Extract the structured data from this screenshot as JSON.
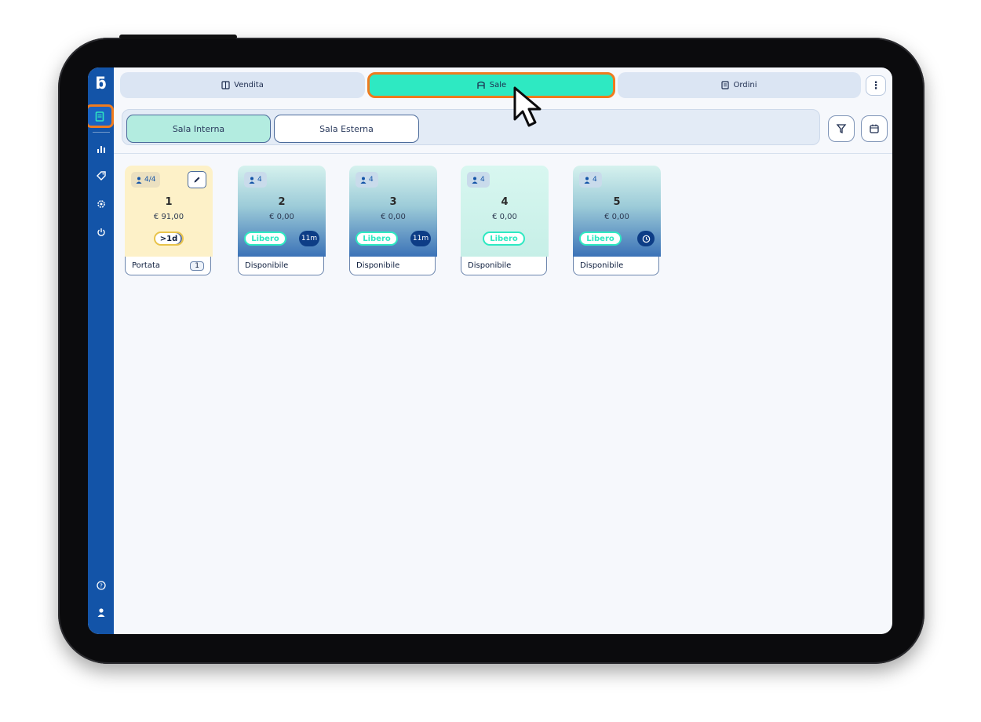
{
  "top_tabs": [
    {
      "label": "Vendita",
      "icon": "register-icon"
    },
    {
      "label": "Sale",
      "icon": "chair-icon"
    },
    {
      "label": "Ordini",
      "icon": "document-icon"
    }
  ],
  "menu_glyph": "⋮",
  "rooms": [
    {
      "label": "Sala Interna"
    },
    {
      "label": "Sala Esterna"
    }
  ],
  "sidebar": {
    "logo": "ƃ",
    "items": [
      "receipt-icon",
      "bar-chart-icon",
      "tag-icon",
      "settings-icon",
      "power-icon"
    ],
    "help_glyph": "?",
    "user_glyph": "👤"
  },
  "tables": [
    {
      "seats": "4/4",
      "number": "1",
      "amount": "€ 91,00",
      "badge": ">1d",
      "status": "Portata",
      "count": "1"
    },
    {
      "seats": "4",
      "number": "2",
      "amount": "€ 0,00",
      "badge": "Libero",
      "time": "11m",
      "status": "Disponibile"
    },
    {
      "seats": "4",
      "number": "3",
      "amount": "€ 0,00",
      "badge": "Libero",
      "time": "11m",
      "status": "Disponibile"
    },
    {
      "seats": "4",
      "number": "4",
      "amount": "€ 0,00",
      "badge": "Libero",
      "status": "Disponibile"
    },
    {
      "seats": "4",
      "number": "5",
      "amount": "€ 0,00",
      "badge": "Libero",
      "status": "Disponibile"
    }
  ],
  "colors": {
    "accent": "#2ee9c2",
    "highlight": "#ef7b1f",
    "sidebar": "#1354a8"
  }
}
